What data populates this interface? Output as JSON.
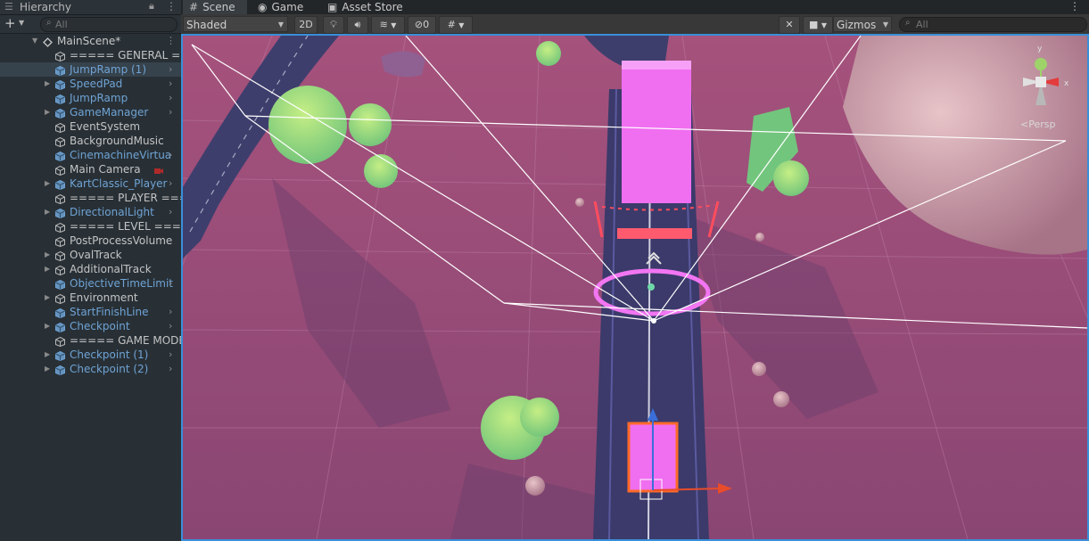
{
  "hierarchy": {
    "title": "Hierarchy",
    "search_placeholder": "All",
    "items": [
      {
        "label": "MainScene*",
        "type": "scene",
        "indent": 0,
        "foldable": true,
        "arrow": false
      },
      {
        "label": "===== GENERAL =====",
        "type": "plain",
        "indent": 1,
        "foldable": false,
        "arrow": false
      },
      {
        "label": "JumpRamp (1)",
        "type": "prefab",
        "indent": 1,
        "foldable": false,
        "arrow": true,
        "selected": true
      },
      {
        "label": "SpeedPad",
        "type": "prefab",
        "indent": 1,
        "foldable": true,
        "arrow": true
      },
      {
        "label": "JumpRamp",
        "type": "prefab",
        "indent": 1,
        "foldable": false,
        "arrow": true
      },
      {
        "label": "GameManager",
        "type": "prefab",
        "indent": 1,
        "foldable": true,
        "arrow": true
      },
      {
        "label": "EventSystem",
        "type": "plain",
        "indent": 1,
        "foldable": false,
        "arrow": false
      },
      {
        "label": "BackgroundMusic",
        "type": "plain",
        "indent": 1,
        "foldable": false,
        "arrow": false
      },
      {
        "label": "CinemachineVirtua",
        "type": "prefab",
        "indent": 1,
        "foldable": false,
        "arrow": true
      },
      {
        "label": "Main Camera",
        "type": "plain",
        "indent": 1,
        "foldable": false,
        "arrow": false,
        "camera": true
      },
      {
        "label": "KartClassic_Player",
        "type": "prefab",
        "indent": 1,
        "foldable": true,
        "arrow": true
      },
      {
        "label": "===== PLAYER =====",
        "type": "plain",
        "indent": 1,
        "foldable": false,
        "arrow": false
      },
      {
        "label": "DirectionalLight",
        "type": "prefab",
        "indent": 1,
        "foldable": true,
        "arrow": true
      },
      {
        "label": "===== LEVEL =====",
        "type": "plain",
        "indent": 1,
        "foldable": false,
        "arrow": false
      },
      {
        "label": "PostProcessVolume",
        "type": "plain",
        "indent": 1,
        "foldable": false,
        "arrow": false
      },
      {
        "label": "OvalTrack",
        "type": "plain",
        "indent": 1,
        "foldable": true,
        "arrow": false
      },
      {
        "label": "AdditionalTrack",
        "type": "plain",
        "indent": 1,
        "foldable": true,
        "arrow": false
      },
      {
        "label": "ObjectiveTimeLimit",
        "type": "prefab",
        "indent": 1,
        "foldable": false,
        "arrow": true
      },
      {
        "label": "Environment",
        "type": "plain",
        "indent": 1,
        "foldable": true,
        "arrow": false
      },
      {
        "label": "StartFinishLine",
        "type": "prefab",
        "indent": 1,
        "foldable": false,
        "arrow": true
      },
      {
        "label": "Checkpoint",
        "type": "prefab",
        "indent": 1,
        "foldable": true,
        "arrow": true
      },
      {
        "label": "===== GAME MODE =====",
        "type": "plain",
        "indent": 1,
        "foldable": false,
        "arrow": false
      },
      {
        "label": "Checkpoint (1)",
        "type": "prefab",
        "indent": 1,
        "foldable": true,
        "arrow": true
      },
      {
        "label": "Checkpoint (2)",
        "type": "prefab",
        "indent": 1,
        "foldable": true,
        "arrow": true
      }
    ]
  },
  "tabs": [
    {
      "label": "Scene",
      "icon": "grid-icon",
      "active": true
    },
    {
      "label": "Game",
      "icon": "gamepad-icon",
      "active": false
    },
    {
      "label": "Asset Store",
      "icon": "store-icon",
      "active": false
    }
  ],
  "toolbar": {
    "shading_mode": "Shaded",
    "mode_2d": "2D",
    "effects_count": "0",
    "gizmos_label": "Gizmos",
    "search_placeholder": "All"
  },
  "viewport": {
    "projection_label": "Persp",
    "gizmo_axes": [
      "y",
      "x"
    ]
  },
  "colors": {
    "ground": "#9a4f7c",
    "track": "#3e3e6d",
    "selection": "#3a8fd8",
    "prefab_text": "#6fa3d4",
    "pink_ramp": "#f06ef0"
  }
}
